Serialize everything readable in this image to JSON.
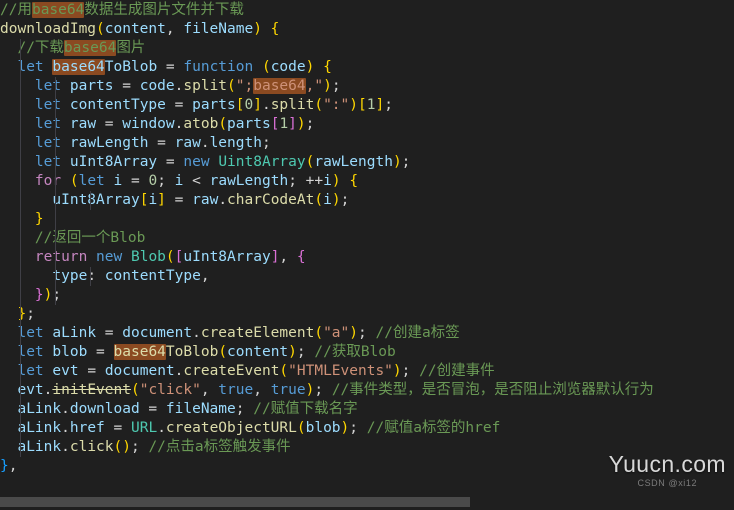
{
  "editor": {
    "theme_name": "dark-plus",
    "background": "#1f1f1f",
    "search_highlight_color": "#8b4a21",
    "comment_color": "#6a9955",
    "string_color": "#ce9178",
    "keyword_color": "#c586c0",
    "declaration_color": "#569cd6",
    "function_color": "#dcdcaa",
    "class_color": "#4ec9b0",
    "variable_color": "#9cdcfe",
    "search_term": "base64",
    "language": "javascript"
  },
  "code": {
    "lines": [
      "//用base64数据生成图片文件并下载",
      "downloadImg(content, fileName) {",
      "  //下载base64图片",
      "  let base64ToBlob = function (code) {",
      "    let parts = code.split(\";base64,\");",
      "    let contentType = parts[0].split(\":\")[1];",
      "    let raw = window.atob(parts[1]);",
      "    let rawLength = raw.length;",
      "    let uInt8Array = new Uint8Array(rawLength);",
      "    for (let i = 0; i < rawLength; ++i) {",
      "      uInt8Array[i] = raw.charCodeAt(i);",
      "    }",
      "    //返回一个Blob",
      "    return new Blob([uInt8Array], {",
      "      type: contentType,",
      "    });",
      "  };",
      "  let aLink = document.createElement(\"a\"); //创建a标签",
      "  let blob = base64ToBlob(content); //获取Blob",
      "  let evt = document.createEvent(\"HTMLEvents\"); //创建事件",
      "  evt.initEvent(\"click\", true, true); //事件类型，是否冒泡，是否阻止浏览器默认行为",
      "  aLink.download = fileName; //赋值下载名字",
      "  aLink.href = URL.createObjectURL(blob); //赋值a标签的href",
      "  aLink.click(); //点击a标签触发事件",
      "},"
    ],
    "deprecated_members": [
      "initEvent"
    ],
    "comments": [
      "//用base64数据生成图片文件并下载",
      "//下载base64图片",
      "//返回一个Blob",
      "//创建a标签",
      "//获取Blob",
      "//创建事件",
      "//事件类型，是否冒泡，是否阻止浏览器默认行为",
      "//赋值下载名字",
      "//赋值a标签的href",
      "//点击a标签触发事件"
    ]
  },
  "watermark": {
    "main": "Yuucn.com",
    "sub": "CSDN @xi12"
  },
  "scrollbar": {
    "orientation": "horizontal",
    "thumb_color": "#4a4a4a"
  }
}
